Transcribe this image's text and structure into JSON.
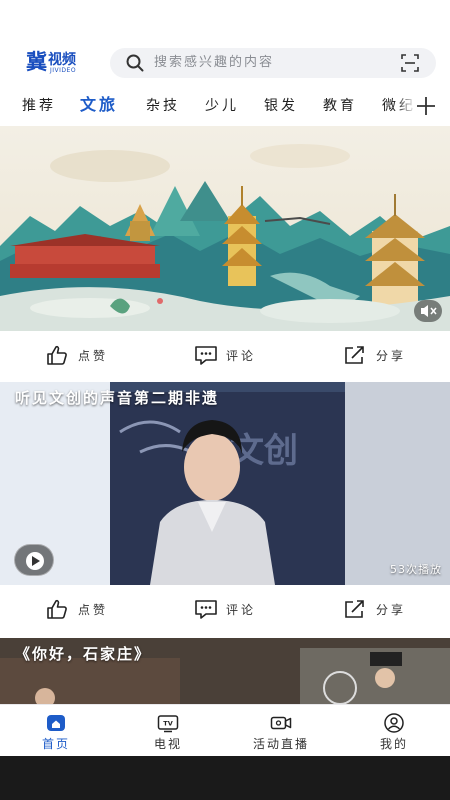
{
  "header": {
    "logo_main": "冀",
    "logo_sub": "视频",
    "logo_en": "JIVIDEO",
    "search_placeholder": "搜索感兴趣的内容"
  },
  "tabs": [
    {
      "label": "推荐",
      "active": false
    },
    {
      "label": "文旅",
      "active": true
    },
    {
      "label": "杂技",
      "active": false
    },
    {
      "label": "少儿",
      "active": false
    },
    {
      "label": "银发",
      "active": false
    },
    {
      "label": "教育",
      "active": false
    },
    {
      "label": "微纪",
      "active": false
    }
  ],
  "feed": {
    "actions": {
      "like": "点赞",
      "comment": "评论",
      "share": "分享"
    },
    "video2": {
      "title": "听见文创的声音第二期非遗",
      "play_count": "53次播放"
    },
    "video3": {
      "title": "《你好，石家庄》"
    }
  },
  "bottom_nav": [
    {
      "label": "首页",
      "icon": "home-icon",
      "active": true
    },
    {
      "label": "电视",
      "icon": "tv-icon",
      "active": false
    },
    {
      "label": "活动直播",
      "icon": "live-camera-icon",
      "active": false
    },
    {
      "label": "我的",
      "icon": "profile-icon",
      "active": false
    }
  ],
  "colors": {
    "accent": "#1e5cc8",
    "brand": "#1a4fbf",
    "search_bg": "#f1f2f5",
    "text": "#222222"
  }
}
